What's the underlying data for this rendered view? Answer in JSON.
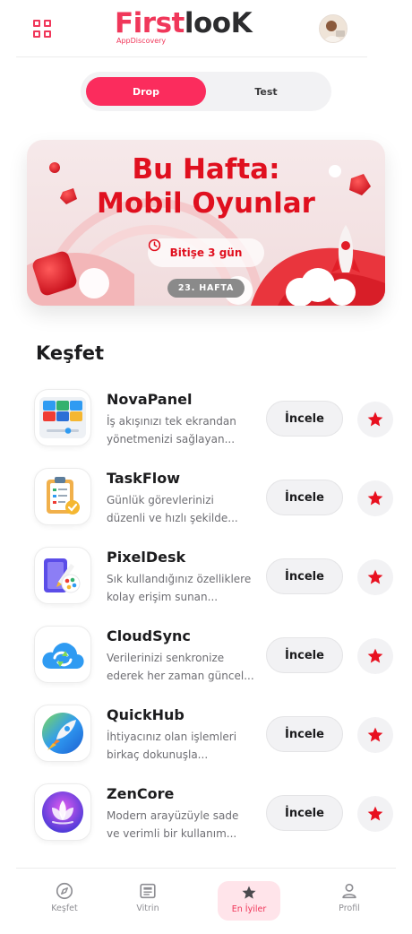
{
  "header": {
    "logo_first": "First",
    "logo_look": "looK",
    "logo_sub": "AppDiscovery"
  },
  "segment": {
    "active": "Drop",
    "inactive": "Test"
  },
  "banner": {
    "title": "Bu Hafta:\nMobil Oyunlar",
    "time_left": "Bitişe 3 gün",
    "week": "23. HAFTA"
  },
  "section_title": "Keşfet",
  "review_label": "İncele",
  "apps": [
    {
      "name": "NovaPanel",
      "desc": "İş akışınızı tek ekrandan\nyönetmenizi sağlayan...",
      "icon": "dashboard-icon"
    },
    {
      "name": "TaskFlow",
      "desc": "Günlük görevlerinizi\ndüzenli ve hızlı şekilde...",
      "icon": "clipboard-check-icon"
    },
    {
      "name": "PixelDesk",
      "desc": "Sık kullandığınız özelliklere\nkolay erişim sunan...",
      "icon": "palette-icon"
    },
    {
      "name": "CloudSync",
      "desc": "Verilerinizi senkronize\nederek her zaman güncel...",
      "icon": "cloud-sync-icon"
    },
    {
      "name": "QuickHub",
      "desc": "İhtiyacınız olan işlemleri\nbirkaç dokunuşla...",
      "icon": "rocket-icon"
    },
    {
      "name": "ZenCore",
      "desc": "Modern arayüzüyle sade\nve verimli bir kullanım...",
      "icon": "lotus-icon"
    }
  ],
  "nav": {
    "explore": "Keşfet",
    "showcase": "Vitrin",
    "best": "En İyiler",
    "profile": "Profil"
  },
  "colors": {
    "accent": "#fb2c5d",
    "brand": "#f0375a",
    "star": "#e8101f"
  }
}
